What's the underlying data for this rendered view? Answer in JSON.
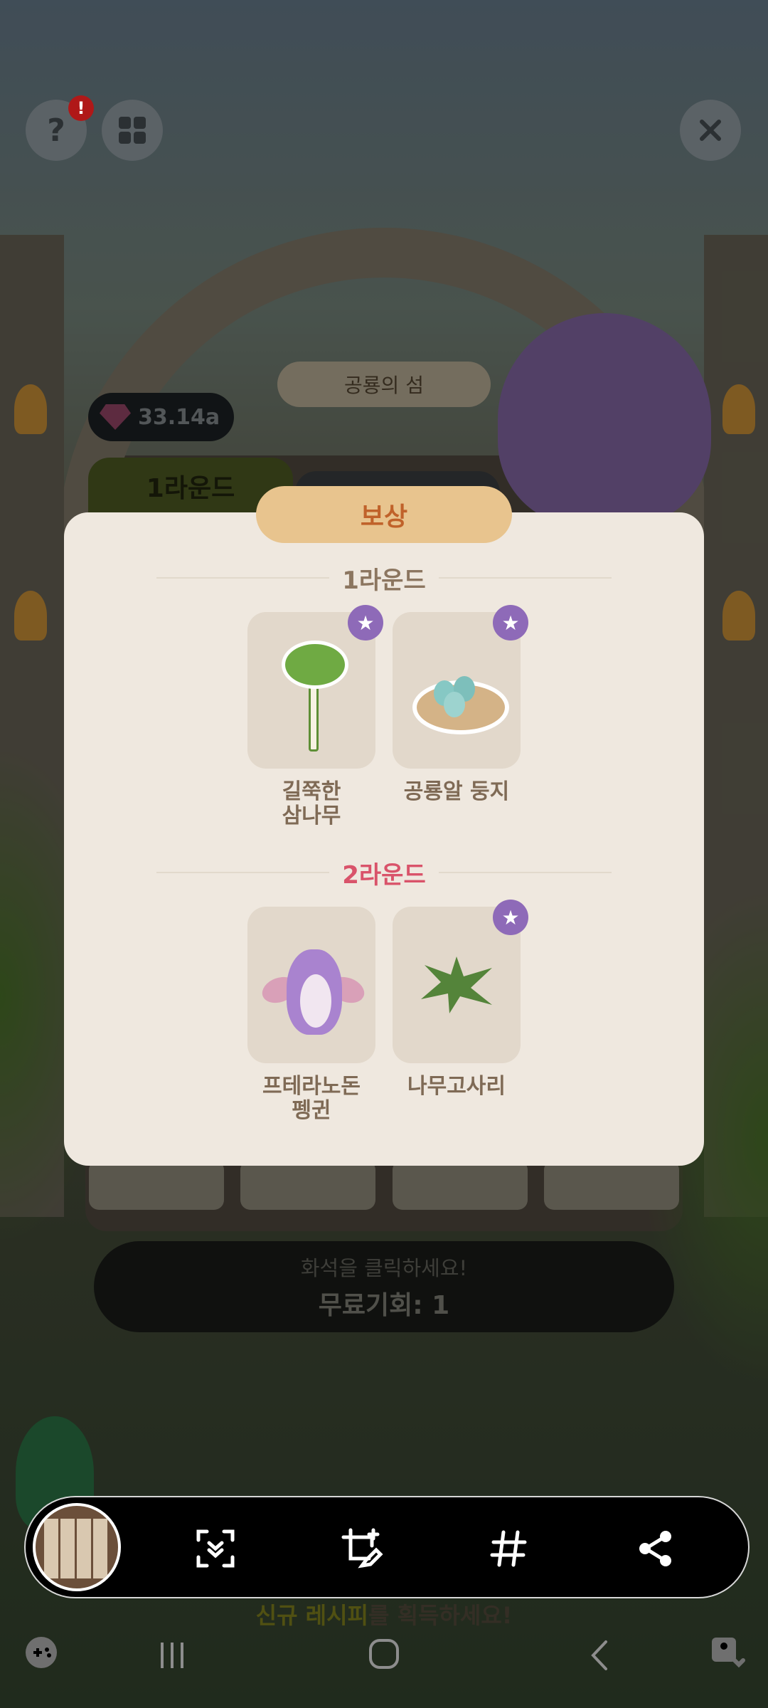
{
  "background": {
    "sign_title": "공룡의 섬",
    "gem_value": "33.14a",
    "round_tab_1": "1라운드",
    "hint_line_1": "화석을 클릭하세요!",
    "hint_line_2": "무료기회: 1",
    "bottom_highlight": "신규 레시피",
    "bottom_rest": "를 획득하세요!",
    "help_icon": "help-icon",
    "menu_icon": "grid-icon",
    "close_icon": "close-icon",
    "notification_badge": "!"
  },
  "modal": {
    "title": "보상",
    "rounds": [
      {
        "label": "1라운드",
        "items": [
          {
            "name_line1": "길쭉한",
            "name_line2": "삼나무",
            "starred": true
          },
          {
            "name_line1": "공룡알 둥지",
            "name_line2": "",
            "starred": true
          }
        ]
      },
      {
        "label": "2라운드",
        "items": [
          {
            "name_line1": "프테라노돈",
            "name_line2": "펭귄",
            "starred": false
          },
          {
            "name_line1": "나무고사리",
            "name_line2": "",
            "starred": true
          }
        ]
      }
    ]
  },
  "toolbar": {
    "buttons": [
      "scroll-capture-icon",
      "crop-edit-icon",
      "hashtag-icon",
      "share-icon"
    ]
  },
  "navigation": {
    "buttons": [
      "game-tools-icon",
      "recent-apps-icon",
      "home-icon",
      "back-icon",
      "accessibility-icon"
    ]
  },
  "colors": {
    "modal_bg": "#efe8df",
    "title_pill": "#e8c48e",
    "title_text": "#c0622a",
    "round1_text": "#8c7660",
    "round2_text": "#d9536a",
    "star_badge": "#8e6ab8"
  }
}
